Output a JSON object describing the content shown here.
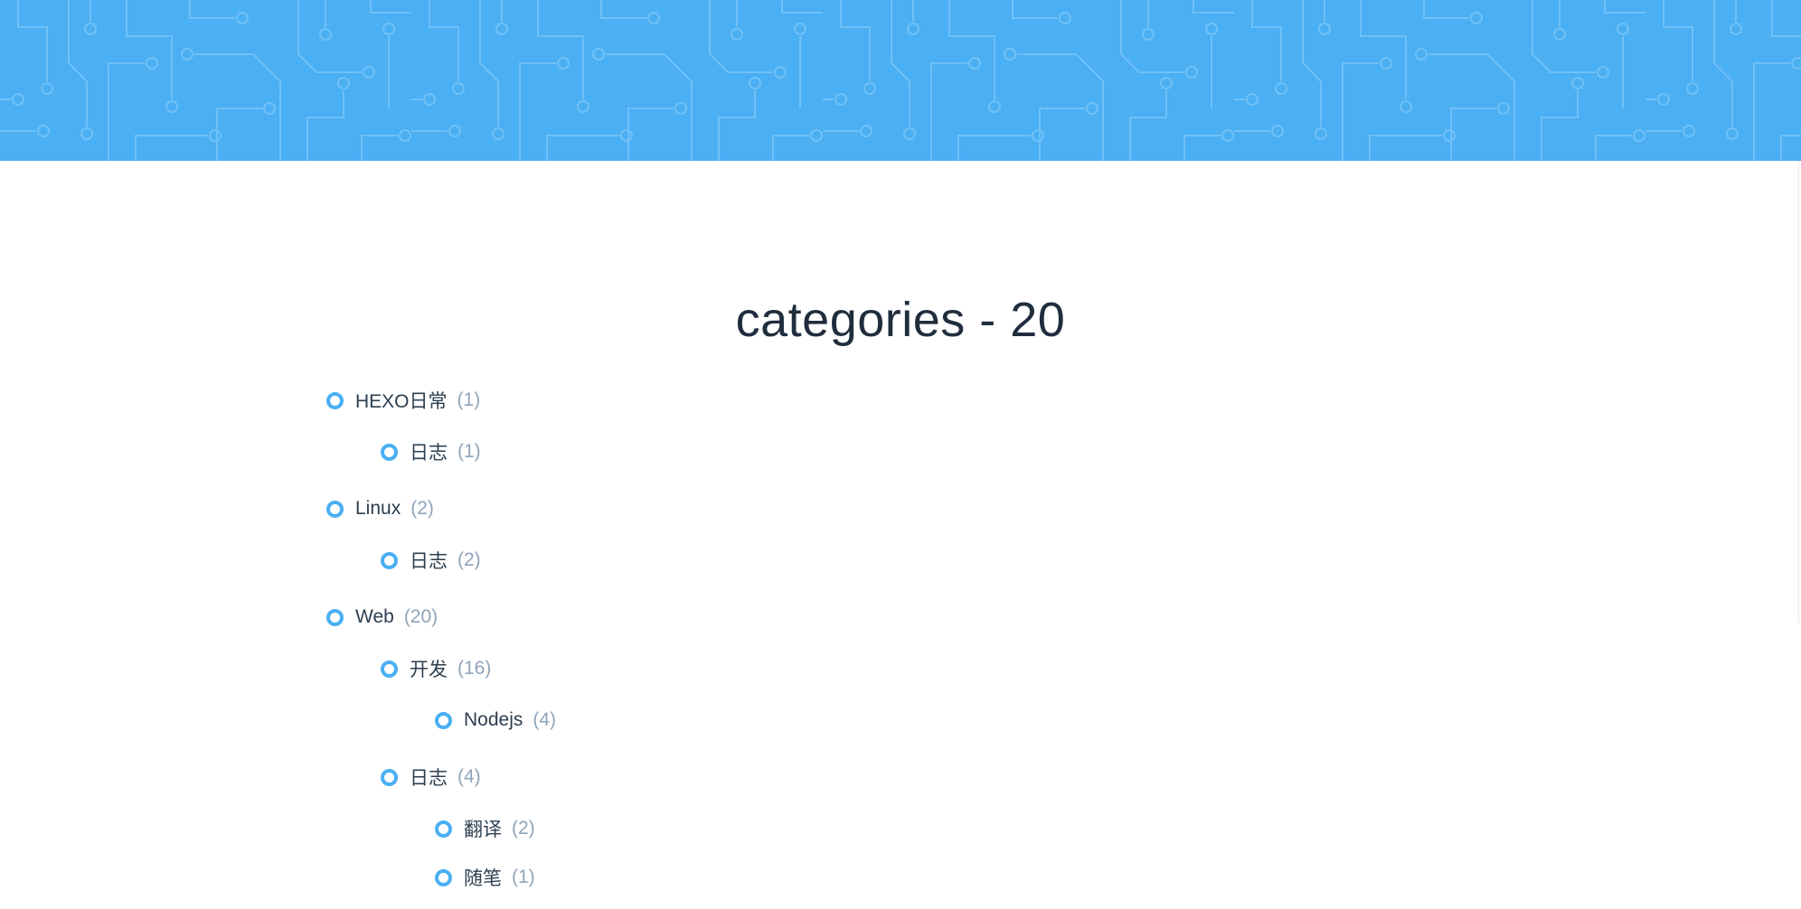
{
  "banner": {
    "pattern": "circuit-board-pattern",
    "color": "#4aaff3",
    "line_color": "#7cc7f7"
  },
  "title": "categories - 20",
  "categories": [
    {
      "name": "HEXO日常",
      "count": "(1)",
      "level": 1
    },
    {
      "name": "日志",
      "count": "(1)",
      "level": 2
    },
    {
      "name": "Linux",
      "count": "(2)",
      "level": 1
    },
    {
      "name": "日志",
      "count": "(2)",
      "level": 2
    },
    {
      "name": "Web",
      "count": "(20)",
      "level": 1
    },
    {
      "name": "开发",
      "count": "(16)",
      "level": 2
    },
    {
      "name": "Nodejs",
      "count": "(4)",
      "level": 3
    },
    {
      "name": "日志",
      "count": "(4)",
      "level": 2
    },
    {
      "name": "翻译",
      "count": "(2)",
      "level": 3
    },
    {
      "name": "随笔",
      "count": "(1)",
      "level": 3
    }
  ],
  "colors": {
    "accent": "#4aaff3",
    "title": "#1f2d3d",
    "text": "#2c3e50",
    "count": "#8fa4bb"
  }
}
